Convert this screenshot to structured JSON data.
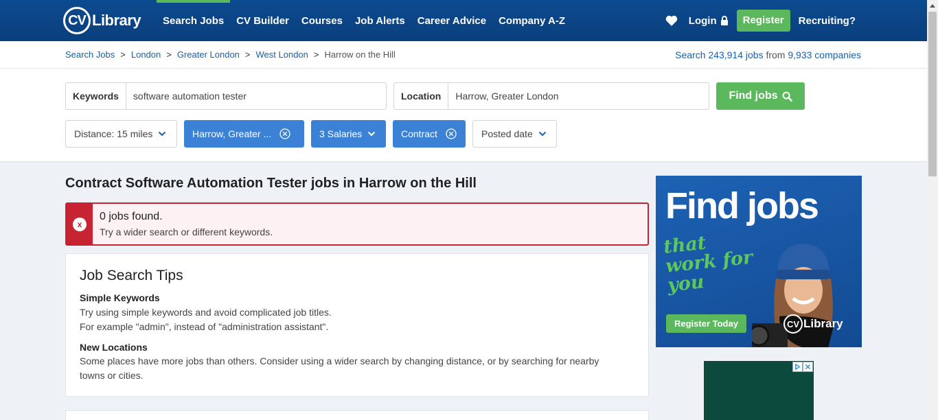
{
  "header": {
    "logo_cv": "CV",
    "logo_text": "Library",
    "nav": [
      "Search Jobs",
      "CV Builder",
      "Courses",
      "Job Alerts",
      "Career Advice",
      "Company A-Z"
    ],
    "login": "Login",
    "register": "Register",
    "recruiting": "Recruiting?",
    "accent_color": "#5cb85c",
    "brand_color": "#0c4a8f"
  },
  "breadcrumb": {
    "items": [
      "Search Jobs",
      "London",
      "Greater London",
      "West London"
    ],
    "current": "Harrow on the Hill",
    "stats_prefix": "Search ",
    "jobs_count": "243,914 jobs",
    "stats_mid": " from ",
    "companies": "9,933 companies"
  },
  "search": {
    "keywords_label": "Keywords",
    "keywords_value": "software automation tester",
    "location_label": "Location",
    "location_value": "Harrow, Greater London",
    "find_button": "Find jobs"
  },
  "filters": {
    "distance": "Distance: 15 miles",
    "location_chip": "Harrow, Greater ...",
    "salaries": "3 Salaries",
    "contract": "Contract",
    "posted": "Posted date"
  },
  "main": {
    "title": "Contract Software Automation Tester jobs in Harrow on the Hill",
    "alert_title": "0 jobs found.",
    "alert_sub": "Try a wider search or different keywords.",
    "alert_icon": "x",
    "tips_title": "Job Search Tips",
    "tip1_head": "Simple Keywords",
    "tip1_line1": "Try using simple keywords and avoid complicated job titles.",
    "tip1_line2": "For example \"admin\", instead of \"administration assistant\".",
    "tip2_head": "New Locations",
    "tip2_line1": "Some places have more jobs than others. Consider using a wider search by changing distance, or by searching for nearby",
    "tip2_line2": "towns or cities."
  },
  "ad": {
    "headline": "Find jobs",
    "script": "that work for you",
    "register": "Register Today",
    "logo_cv": "CV",
    "logo_text": "Library"
  }
}
